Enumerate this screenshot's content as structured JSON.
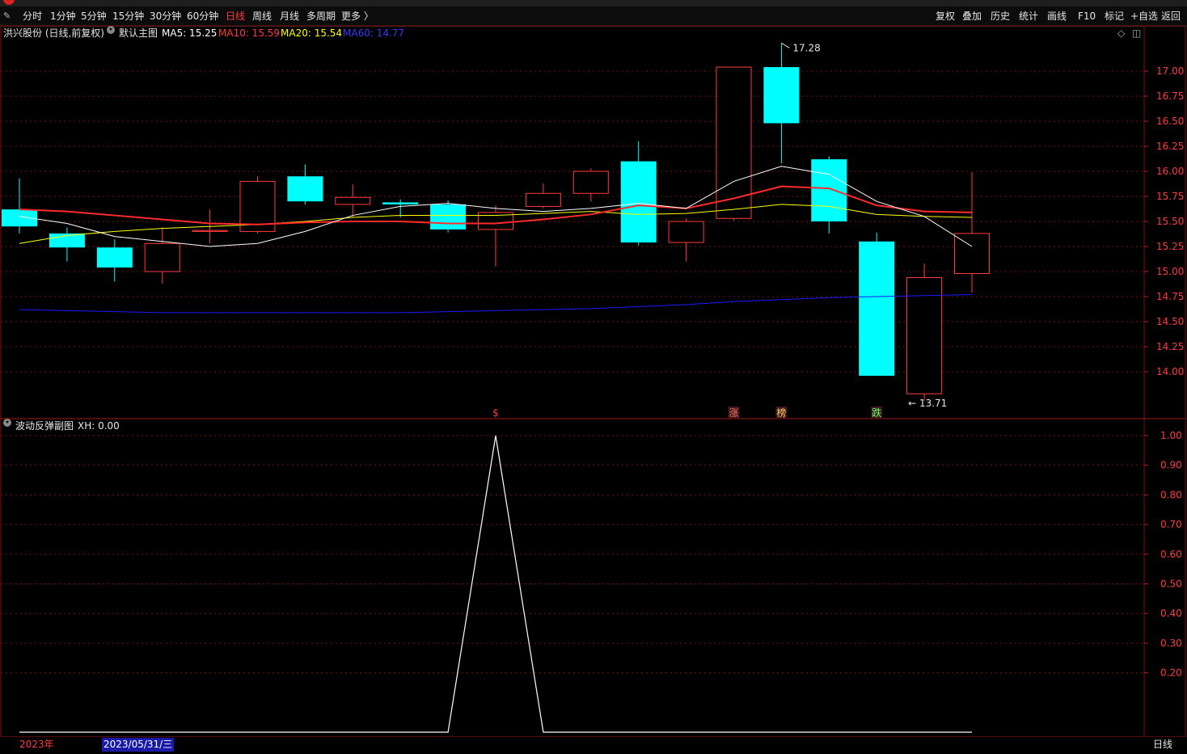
{
  "toolbar": {
    "left_items": [
      "分时",
      "1分钟",
      "5分钟",
      "15分钟",
      "30分钟",
      "60分钟",
      "日线",
      "周线",
      "月线",
      "多周期",
      "更多 〉"
    ],
    "active": "日线",
    "right_items": [
      "复权",
      "叠加",
      "历史",
      "统计",
      "画线",
      "F10",
      "标记",
      "+自选",
      "返回"
    ]
  },
  "main_info": {
    "stock": "洪兴股份 (日线,前复权)",
    "template": "默认主图",
    "ma5": "MA5: 15.25",
    "ma10": "MA10: 15.59",
    "ma20": "MA20: 15.54",
    "ma60": "MA60: 14.77"
  },
  "sub_info": {
    "name": "波动反弹副图",
    "value": "XH: 0.00"
  },
  "colors": {
    "up": "#ff3b3b",
    "down": "#00ffff",
    "ma5": "#ffffff",
    "ma10": "#ff2a2a",
    "ma20": "#ffff00",
    "ma60": "#1a1aff",
    "grid": "#7a1010"
  },
  "chart_data": [
    {
      "type": "candlestick",
      "price_axis_ticks": [
        "17.00",
        "16.75",
        "16.50",
        "16.25",
        "16.00",
        "15.75",
        "15.50",
        "15.25",
        "15.00",
        "14.75",
        "14.50",
        "14.25",
        "14.00"
      ],
      "ylim": [
        13.6,
        17.35
      ],
      "candles": [
        {
          "open": 15.62,
          "close": 15.45,
          "high": 15.93,
          "low": 15.38
        },
        {
          "open": 15.38,
          "close": 15.24,
          "high": 15.44,
          "low": 15.1
        },
        {
          "open": 15.24,
          "close": 15.04,
          "high": 15.32,
          "low": 14.9
        },
        {
          "open": 15.0,
          "close": 15.28,
          "high": 15.44,
          "low": 14.88
        },
        {
          "open": 15.4,
          "close": 15.41,
          "high": 15.62,
          "low": 15.28
        },
        {
          "open": 15.4,
          "close": 15.9,
          "high": 15.95,
          "low": 15.38
        },
        {
          "open": 15.95,
          "close": 15.7,
          "high": 16.07,
          "low": 15.67
        },
        {
          "open": 15.67,
          "close": 15.74,
          "high": 15.87,
          "low": 15.54
        },
        {
          "open": 15.69,
          "close": 15.67,
          "high": 15.72,
          "low": 15.54
        },
        {
          "open": 15.67,
          "close": 15.42,
          "high": 15.71,
          "low": 15.39
        },
        {
          "open": 15.42,
          "close": 15.59,
          "high": 15.66,
          "low": 15.05
        },
        {
          "open": 15.65,
          "close": 15.78,
          "high": 15.88,
          "low": 15.63
        },
        {
          "open": 15.78,
          "close": 16.0,
          "high": 16.03,
          "low": 15.7
        },
        {
          "open": 16.1,
          "close": 15.29,
          "high": 16.3,
          "low": 15.26
        },
        {
          "open": 15.29,
          "close": 15.5,
          "high": 15.53,
          "low": 15.1
        },
        {
          "open": 15.53,
          "close": 17.04,
          "high": 17.04,
          "low": 15.51
        },
        {
          "open": 17.04,
          "close": 16.48,
          "high": 17.28,
          "low": 16.08
        },
        {
          "open": 16.12,
          "close": 15.5,
          "high": 16.15,
          "low": 15.38
        },
        {
          "open": 15.3,
          "close": 13.96,
          "high": 15.39,
          "low": 13.96
        },
        {
          "open": 13.78,
          "close": 14.94,
          "high": 15.08,
          "low": 13.71
        },
        {
          "open": 14.98,
          "close": 15.38,
          "high": 15.99,
          "low": 14.79
        }
      ],
      "ma5": [
        15.55,
        15.48,
        15.35,
        15.3,
        15.25,
        15.28,
        15.4,
        15.56,
        15.65,
        15.68,
        15.63,
        15.6,
        15.63,
        15.68,
        15.63,
        15.9,
        16.05,
        15.97,
        15.7,
        15.55,
        15.25
      ],
      "ma10": [
        15.62,
        15.6,
        15.56,
        15.52,
        15.48,
        15.47,
        15.49,
        15.5,
        15.5,
        15.48,
        15.48,
        15.52,
        15.57,
        15.66,
        15.63,
        15.73,
        15.85,
        15.83,
        15.66,
        15.6,
        15.59
      ],
      "ma20": [
        15.28,
        15.36,
        15.4,
        15.43,
        15.45,
        15.47,
        15.5,
        15.54,
        15.56,
        15.56,
        15.56,
        15.58,
        15.6,
        15.57,
        15.58,
        15.62,
        15.67,
        15.65,
        15.57,
        15.55,
        15.54
      ],
      "ma60": [
        14.62,
        14.61,
        14.6,
        14.59,
        14.59,
        14.59,
        14.59,
        14.59,
        14.59,
        14.6,
        14.61,
        14.62,
        14.63,
        14.65,
        14.67,
        14.7,
        14.72,
        14.74,
        14.75,
        14.76,
        14.77
      ],
      "annotations": {
        "high": "17.28",
        "low": "13.71"
      },
      "markers": [
        {
          "candle": 10,
          "text": "$",
          "color": "#ff3b3b"
        },
        {
          "candle": 15,
          "text": "涨",
          "color": "#ff6b6b"
        },
        {
          "candle": 16,
          "text": "榜",
          "color": "#ffcc66"
        },
        {
          "candle": 18,
          "text": "跌",
          "color": "#66ff66"
        }
      ]
    },
    {
      "type": "line",
      "name": "XH",
      "y_axis_ticks": [
        "1.00",
        "0.90",
        "0.80",
        "0.70",
        "0.60",
        "0.50",
        "0.40",
        "0.30",
        "0.20"
      ],
      "ylim": [
        -0.02,
        1.05
      ],
      "x": [
        0,
        1,
        2,
        3,
        4,
        5,
        6,
        7,
        8,
        9,
        10,
        11,
        12,
        13,
        14,
        15,
        16,
        17,
        18,
        19,
        20
      ],
      "values": [
        0,
        0,
        0,
        0,
        0,
        0,
        0,
        0,
        0,
        0,
        1,
        0,
        0,
        0,
        0,
        0,
        0,
        0,
        0,
        0,
        0
      ]
    }
  ],
  "bottom": {
    "year": "2023年",
    "date": "2023/05/31/三",
    "period": "日线"
  }
}
